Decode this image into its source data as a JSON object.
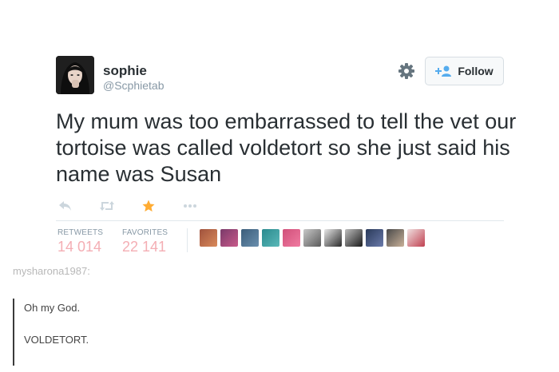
{
  "tweet": {
    "display_name": "sophie",
    "handle": "@Scphietab",
    "follow_label": "Follow",
    "text": "My mum was too embarrassed to tell the vet our tortoise was called voldetort so she just said his name was Susan",
    "actions": [
      "reply-icon",
      "retweet-icon",
      "favorite-star-icon",
      "more-icon"
    ],
    "stats": {
      "retweets_label": "RETWEETS",
      "retweets_count": "14 014",
      "favorites_label": "FAVORITES",
      "favorites_count": "22 141"
    },
    "favoriter_avatar_count": 10,
    "colors": {
      "accent": "#55acee",
      "star": "#ffac33",
      "stat_number": "#f4aeb4"
    }
  },
  "reblog": {
    "username": "mysharona1987",
    "separator": ":",
    "lines": [
      "Oh my God.",
      "VOLDETORT."
    ]
  }
}
